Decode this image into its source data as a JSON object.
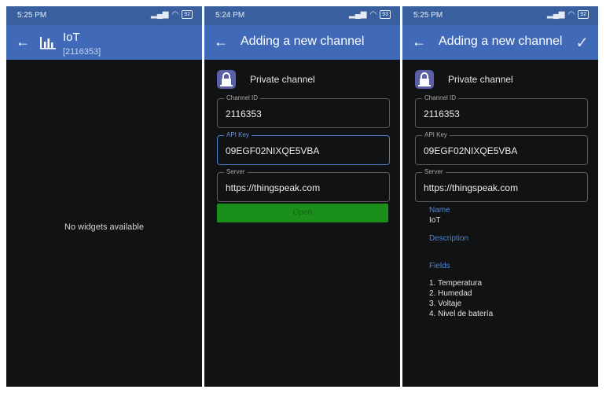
{
  "screen1": {
    "status_time": "5:25 PM",
    "battery": "92",
    "title": "IoT",
    "channel": "[2116353]",
    "empty_text": "No widgets available"
  },
  "screen2": {
    "status_time": "5:24 PM",
    "battery": "93",
    "title": "Adding a new channel",
    "channel_type": "Private channel",
    "channel_id_label": "Channel ID",
    "channel_id": "2116353",
    "api_key_label": "API Key",
    "api_key": "09EGF02NIXQE5VBA",
    "server_label": "Server",
    "server": "https://thingspeak.com",
    "open_label": "Open"
  },
  "screen3": {
    "status_time": "5:25 PM",
    "battery": "92",
    "title": "Adding a new channel",
    "channel_type": "Private channel",
    "channel_id_label": "Channel ID",
    "channel_id": "2116353",
    "api_key_label": "API Key",
    "api_key": "09EGF02NIXQE5VBA",
    "server_label": "Server",
    "server": "https://thingspeak.com",
    "name_label": "Name",
    "name": "IoT",
    "description_label": "Description",
    "fields_label": "Fields",
    "fields": [
      "1. Temperatura",
      "2. Humedad",
      "3. Voltaje",
      "4. Nivel de batería"
    ]
  },
  "colors": {
    "accent": "#4069b8",
    "open_button": "#1b8f1b",
    "link": "#4a86d6"
  },
  "icons": [
    "back-arrow-icon",
    "bar-chart-icon",
    "lock-icon",
    "check-icon",
    "signal-icon",
    "wifi-icon",
    "battery-icon"
  ]
}
